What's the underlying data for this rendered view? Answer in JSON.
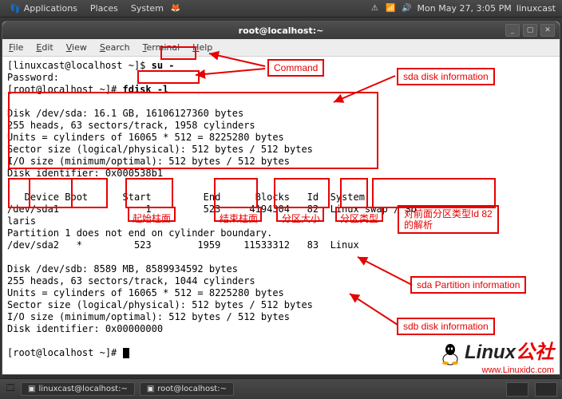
{
  "top_panel": {
    "menus": [
      "Applications",
      "Places",
      "System"
    ],
    "clock": "Mon May 27,  3:05 PM",
    "user": "linuxcast"
  },
  "window": {
    "title": "root@localhost:~",
    "menubar": [
      "File",
      "Edit",
      "View",
      "Search",
      "Terminal",
      "Help"
    ]
  },
  "terminal": {
    "prompt1": "[linuxcast@localhost ~]$ ",
    "cmd1": "su -",
    "password_label": "Password:",
    "prompt2": "[root@localhost ~]# ",
    "cmd2": "fdisk -l",
    "sda_header": "Disk /dev/sda: 16.1 GB, 16106127360 bytes",
    "sda_geom": "255 heads, 63 sectors/track, 1958 cylinders",
    "sda_units": "Units = cylinders of 16065 * 512 = 8225280 bytes",
    "sda_sector": "Sector size (logical/physical): 512 bytes / 512 bytes",
    "sda_io": "I/O size (minimum/optimal): 512 bytes / 512 bytes",
    "sda_id": "Disk identifier: 0x000538b1",
    "table_header": "   Device Boot      Start         End      Blocks   Id  System",
    "row1": "/dev/sda1               1         523     4194304   82  Linux swap / So",
    "row1b": "laris",
    "warn": "Partition 1 does not end on cylinder boundary.",
    "row2": "/dev/sda2   *         523        1959    11533312   83  Linux",
    "sdb_header": "Disk /dev/sdb: 8589 MB, 8589934592 bytes",
    "sdb_geom": "255 heads, 63 sectors/track, 1044 cylinders",
    "sdb_units": "Units = cylinders of 16065 * 512 = 8225280 bytes",
    "sdb_sector": "Sector size (logical/physical): 512 bytes / 512 bytes",
    "sdb_io": "I/O size (minimum/optimal): 512 bytes / 512 bytes",
    "sdb_id": "Disk identifier: 0x00000000",
    "prompt3": "[root@localhost ~]# "
  },
  "annotations": {
    "command": "Command",
    "sda_disk": "sda disk information",
    "start_col": "起始柱面",
    "end_col": "结束柱面",
    "blocks": "分区大小",
    "id_col": "分区类型",
    "system_col": "对前面分区类型Id 82",
    "system_col2": "的解析",
    "sda_part": "sda Partition information",
    "sdb_disk": "sdb disk information"
  },
  "taskbar": {
    "task1": "linuxcast@localhost:~",
    "task2": "root@localhost:~"
  },
  "watermark": {
    "brand_black": "Linux",
    "brand_red": "公社",
    "url": "www.Linuxidc.com"
  }
}
